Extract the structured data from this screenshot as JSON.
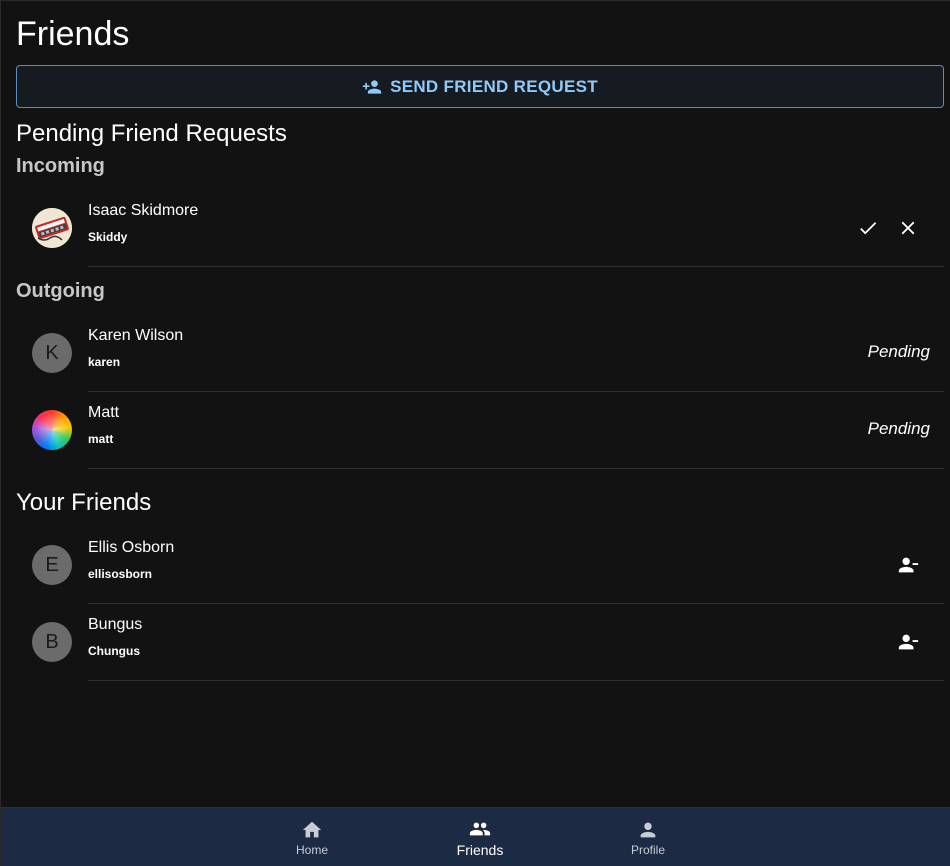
{
  "page": {
    "title": "Friends"
  },
  "send_button": {
    "label": "SEND FRIEND REQUEST",
    "icon": "person-add-icon"
  },
  "pending": {
    "heading": "Pending Friend Requests",
    "incoming_heading": "Incoming",
    "incoming": [
      {
        "name": "Isaac Skidmore",
        "handle": "Skiddy",
        "avatar": "photo",
        "accept_icon": "check-icon",
        "decline_icon": "close-icon"
      }
    ],
    "outgoing_heading": "Outgoing",
    "outgoing": [
      {
        "name": "Karen Wilson",
        "handle": "karen",
        "initial": "K",
        "status": "Pending"
      },
      {
        "name": "Matt",
        "handle": "matt",
        "initial": "",
        "status": "Pending"
      }
    ]
  },
  "friends": {
    "heading": "Your Friends",
    "items": [
      {
        "name": "Ellis Osborn",
        "handle": "ellisosborn",
        "initial": "E",
        "remove_icon": "person-remove-icon"
      },
      {
        "name": "Bungus",
        "handle": "Chungus",
        "initial": "B",
        "remove_icon": "person-remove-icon"
      }
    ]
  },
  "nav": {
    "items": [
      {
        "label": "Home",
        "icon": "home-icon",
        "active": false
      },
      {
        "label": "Friends",
        "icon": "people-icon",
        "active": true
      },
      {
        "label": "Profile",
        "icon": "person-icon",
        "active": false
      }
    ]
  },
  "colors": {
    "background": "#121212",
    "accent": "#90caf9",
    "nav_background": "#1d2a44",
    "avatar_gray": "#6b6b6b"
  }
}
